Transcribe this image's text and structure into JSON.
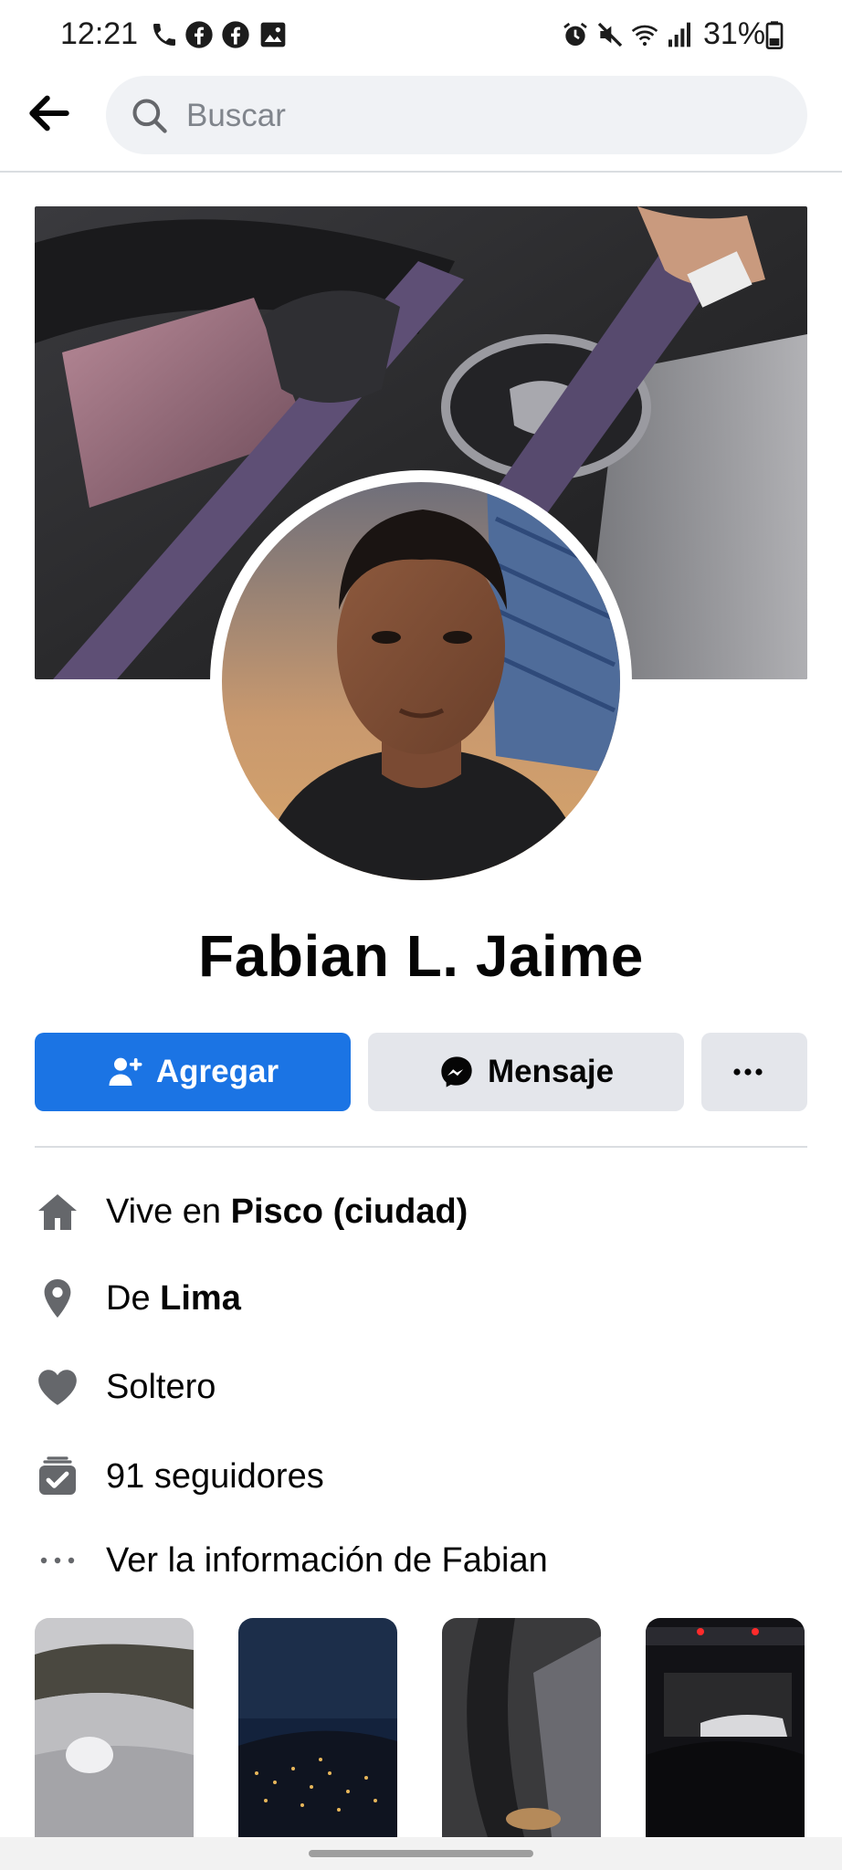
{
  "status_bar": {
    "time": "12:21",
    "battery": "31%",
    "icons": [
      "phone-icon",
      "facebook-icon",
      "facebook-icon",
      "gallery-icon",
      "alarm-icon",
      "mute-icon",
      "wifi-icon",
      "signal-icon",
      "battery-icon"
    ]
  },
  "header": {
    "back_icon": "back-arrow-icon",
    "search_placeholder": "Buscar"
  },
  "profile": {
    "name": "Fabian L. Jaime"
  },
  "actions": {
    "add_label": "Agregar",
    "message_label": "Mensaje",
    "more_label": "···"
  },
  "info": {
    "lives_prefix": "Vive en ",
    "lives_place": "Pisco (ciudad)",
    "from_prefix": "De ",
    "from_place": "Lima",
    "relationship": "Soltero",
    "followers": "91 seguidores",
    "see_info": "Ver la información de Fabian"
  },
  "colors": {
    "primary": "#1b74e4",
    "secondary_button": "#e4e6eb",
    "icon_gray": "#65676b",
    "search_bg": "#f0f2f5"
  }
}
